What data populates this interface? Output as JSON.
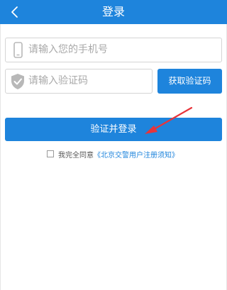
{
  "header": {
    "back_icon": "chevron-left-icon",
    "title": "登录"
  },
  "form": {
    "phone_placeholder": "请输入您的手机号",
    "phone_icon": "phone-icon",
    "code_placeholder": "请输入验证码",
    "code_icon": "shield-check-icon",
    "get_code_label": "获取验证码",
    "submit_label": "验证并登录"
  },
  "agreement": {
    "checked": false,
    "text": "我完全同意",
    "link_text": "《北京交警用户注册须知》"
  },
  "colors": {
    "accent": "#1e84dc",
    "annotation_arrow": "#e8343a"
  }
}
